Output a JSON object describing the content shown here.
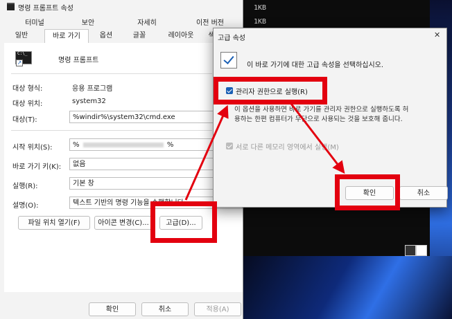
{
  "terminal": {
    "lines": [
      "1KB",
      "1KB"
    ]
  },
  "properties": {
    "title": "명령 프롬프트 속성",
    "tabs_row1": [
      "터미널",
      "보안",
      "자세히",
      "이전 버전"
    ],
    "tabs_row2": [
      "일반",
      "바로 가기",
      "옵션",
      "글꼴",
      "레이아웃",
      "색"
    ],
    "icon_caption": "명령 프롬프트",
    "target_type_label": "대상 형식:",
    "target_type_value": "응용 프로그램",
    "target_location_label": "대상 위치:",
    "target_location_value": "system32",
    "target_label": "대상(T):",
    "target_value": "%windir%\\system32\\cmd.exe",
    "start_in_label": "시작 위치(S):",
    "start_in_value_prefix": "%",
    "start_in_value_suffix": "%",
    "shortcut_key_label": "바로 가기 키(K):",
    "shortcut_key_value": "없음",
    "run_label": "실행(R):",
    "run_value": "기본 창",
    "comment_label": "설명(O):",
    "comment_value": "텍스트 기반의 명령 기능을 수행합니다",
    "open_location_button": "파일 위치 열기(F)",
    "change_icon_button": "아이콘 변경(C)...",
    "advanced_button": "고급(D)...",
    "ok_button": "확인",
    "cancel_button": "취소",
    "apply_button": "적용(A)"
  },
  "advanced": {
    "title": "고급 속성",
    "close_glyph": "✕",
    "description": "이 바로 가기에 대한 고급 속성을 선택하십시오.",
    "run_as_admin_label": "관리자 권한으로 실행(R)",
    "run_as_admin_checked": true,
    "info_line1": "이 옵션을 사용하면 바로 가기를 관리자 권한으로 실행하도록 허",
    "info_line2": "용하는 한편 컴퓨터가 무단으로 사용되는 것을 보호해 줍니다.",
    "separate_memory_label": "서로 다른 메모리 영역에서 실행(M)",
    "separate_memory_checked": true,
    "ok_button": "확인",
    "cancel_button": "취소"
  },
  "colors": {
    "highlight": "#e3000f",
    "accent": "#1a5fb4"
  }
}
